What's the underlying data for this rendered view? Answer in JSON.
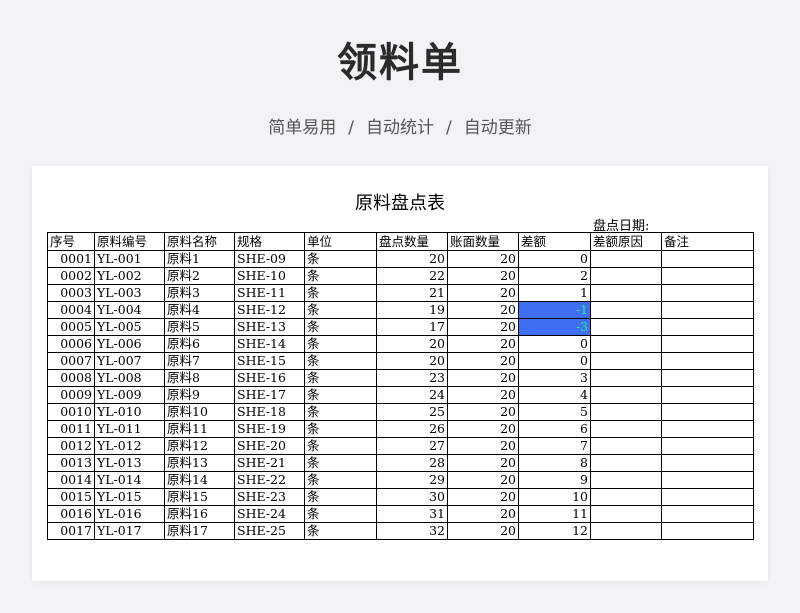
{
  "header": {
    "title": "领料单",
    "features": [
      "简单易用",
      "自动统计",
      "自动更新"
    ],
    "separator": "/"
  },
  "sheet": {
    "title": "原料盘点表",
    "date_label": "盘点日期:",
    "columns": [
      "序号",
      "原料编号",
      "原料名称",
      "规格",
      "单位",
      "盘点数量",
      "账面数量",
      "差额",
      "差额原因",
      "备注"
    ],
    "highlight_color": "#3f6ff2",
    "rows": [
      {
        "no": "0001",
        "code": "YL-001",
        "name": "原料1",
        "spec": "SHE-09",
        "unit": "条",
        "count": "20",
        "book": "20",
        "diff": "0",
        "reason": "",
        "note": ""
      },
      {
        "no": "0002",
        "code": "YL-002",
        "name": "原料2",
        "spec": "SHE-10",
        "unit": "条",
        "count": "22",
        "book": "20",
        "diff": "2",
        "reason": "",
        "note": ""
      },
      {
        "no": "0003",
        "code": "YL-003",
        "name": "原料3",
        "spec": "SHE-11",
        "unit": "条",
        "count": "21",
        "book": "20",
        "diff": "1",
        "reason": "",
        "note": ""
      },
      {
        "no": "0004",
        "code": "YL-004",
        "name": "原料4",
        "spec": "SHE-12",
        "unit": "条",
        "count": "19",
        "book": "20",
        "diff": "-1",
        "reason": "",
        "note": ""
      },
      {
        "no": "0005",
        "code": "YL-005",
        "name": "原料5",
        "spec": "SHE-13",
        "unit": "条",
        "count": "17",
        "book": "20",
        "diff": "-3",
        "reason": "",
        "note": ""
      },
      {
        "no": "0006",
        "code": "YL-006",
        "name": "原料6",
        "spec": "SHE-14",
        "unit": "条",
        "count": "20",
        "book": "20",
        "diff": "0",
        "reason": "",
        "note": ""
      },
      {
        "no": "0007",
        "code": "YL-007",
        "name": "原料7",
        "spec": "SHE-15",
        "unit": "条",
        "count": "20",
        "book": "20",
        "diff": "0",
        "reason": "",
        "note": ""
      },
      {
        "no": "0008",
        "code": "YL-008",
        "name": "原料8",
        "spec": "SHE-16",
        "unit": "条",
        "count": "23",
        "book": "20",
        "diff": "3",
        "reason": "",
        "note": ""
      },
      {
        "no": "0009",
        "code": "YL-009",
        "name": "原料9",
        "spec": "SHE-17",
        "unit": "条",
        "count": "24",
        "book": "20",
        "diff": "4",
        "reason": "",
        "note": ""
      },
      {
        "no": "0010",
        "code": "YL-010",
        "name": "原料10",
        "spec": "SHE-18",
        "unit": "条",
        "count": "25",
        "book": "20",
        "diff": "5",
        "reason": "",
        "note": ""
      },
      {
        "no": "0011",
        "code": "YL-011",
        "name": "原料11",
        "spec": "SHE-19",
        "unit": "条",
        "count": "26",
        "book": "20",
        "diff": "6",
        "reason": "",
        "note": ""
      },
      {
        "no": "0012",
        "code": "YL-012",
        "name": "原料12",
        "spec": "SHE-20",
        "unit": "条",
        "count": "27",
        "book": "20",
        "diff": "7",
        "reason": "",
        "note": ""
      },
      {
        "no": "0013",
        "code": "YL-013",
        "name": "原料13",
        "spec": "SHE-21",
        "unit": "条",
        "count": "28",
        "book": "20",
        "diff": "8",
        "reason": "",
        "note": ""
      },
      {
        "no": "0014",
        "code": "YL-014",
        "name": "原料14",
        "spec": "SHE-22",
        "unit": "条",
        "count": "29",
        "book": "20",
        "diff": "9",
        "reason": "",
        "note": ""
      },
      {
        "no": "0015",
        "code": "YL-015",
        "name": "原料15",
        "spec": "SHE-23",
        "unit": "条",
        "count": "30",
        "book": "20",
        "diff": "10",
        "reason": "",
        "note": ""
      },
      {
        "no": "0016",
        "code": "YL-016",
        "name": "原料16",
        "spec": "SHE-24",
        "unit": "条",
        "count": "31",
        "book": "20",
        "diff": "11",
        "reason": "",
        "note": ""
      },
      {
        "no": "0017",
        "code": "YL-017",
        "name": "原料17",
        "spec": "SHE-25",
        "unit": "条",
        "count": "32",
        "book": "20",
        "diff": "12",
        "reason": "",
        "note": ""
      }
    ]
  }
}
